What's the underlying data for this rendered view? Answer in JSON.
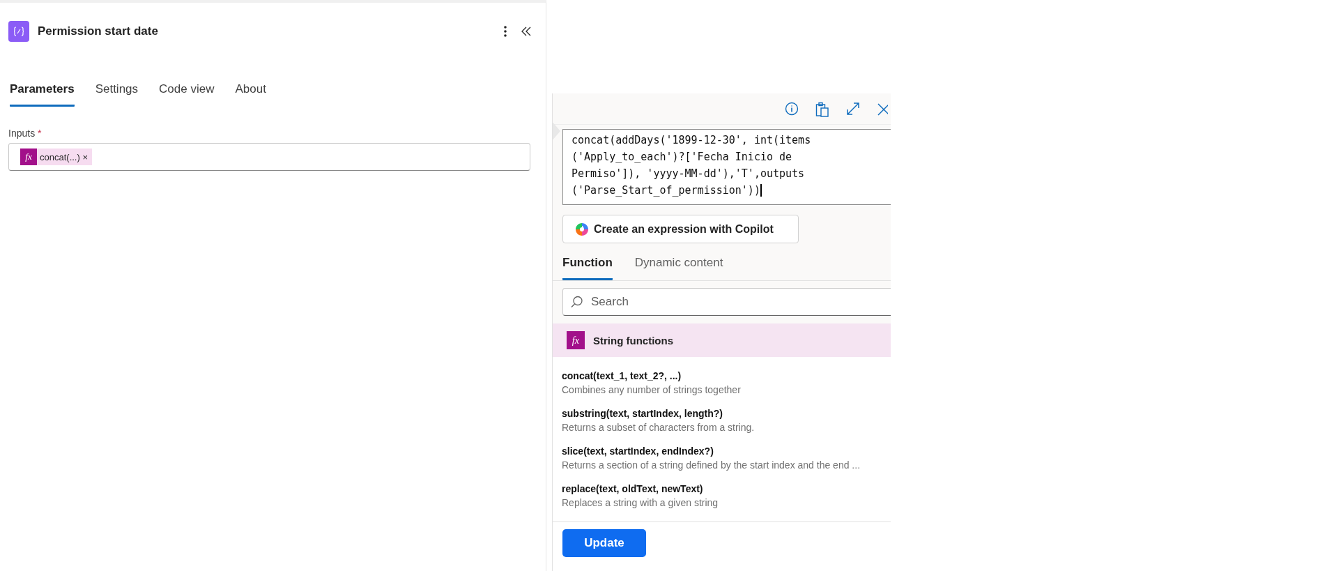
{
  "panel": {
    "title": "Permission start date",
    "tabs": [
      {
        "label": "Parameters",
        "selected": true
      },
      {
        "label": "Settings",
        "selected": false
      },
      {
        "label": "Code view",
        "selected": false
      },
      {
        "label": "About",
        "selected": false
      }
    ],
    "inputs": {
      "label": "Inputs",
      "required_mark": "*",
      "token": {
        "icon": "fx",
        "label": "concat(...)",
        "remove": "×"
      }
    }
  },
  "expression_editor": {
    "expression": "concat(addDays('1899-12-30', int(items\n('Apply_to_each')?['Fecha Inicio de\nPermiso']), 'yyyy-MM-dd'),'T',outputs\n('Parse_Start_of_permission'))",
    "copilot_button": "Create an expression with Copilot",
    "tabs": [
      {
        "label": "Function",
        "selected": true
      },
      {
        "label": "Dynamic content",
        "selected": false
      }
    ],
    "search": {
      "placeholder": "Search"
    },
    "category": {
      "icon": "fx",
      "label": "String functions"
    },
    "functions": [
      {
        "signature": "concat(text_1, text_2?, ...)",
        "description": "Combines any number of strings together"
      },
      {
        "signature": "substring(text, startIndex, length?)",
        "description": "Returns a subset of characters from a string."
      },
      {
        "signature": "slice(text, startIndex, endIndex?)",
        "description": "Returns a section of a string defined by the start index and the end ..."
      },
      {
        "signature": "replace(text, oldText, newText)",
        "description": "Replaces a string with a given string"
      }
    ],
    "update_button": "Update"
  }
}
